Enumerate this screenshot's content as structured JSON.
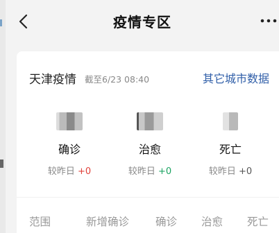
{
  "header": {
    "title": "疫情专区",
    "back_icon": "chevron-left-icon",
    "more_icon": "more-horizontal-icon"
  },
  "card": {
    "region_title": "天津疫情",
    "updated": "截至6/23 08:40",
    "other_cities_link": "其它城市数据",
    "link_color": "#2f5ea8"
  },
  "stats": [
    {
      "label": "确诊",
      "change_prefix": "较昨日",
      "change_value": "+0",
      "change_color": "#e0413a"
    },
    {
      "label": "治愈",
      "change_prefix": "较昨日",
      "change_value": "+0",
      "change_color": "#1aa260"
    },
    {
      "label": "死亡",
      "change_prefix": "较昨日",
      "change_value": "+0",
      "change_color": "#555555"
    }
  ],
  "table": {
    "columns": [
      "范围",
      "新增确诊",
      "确诊",
      "治愈",
      "死亡"
    ]
  }
}
